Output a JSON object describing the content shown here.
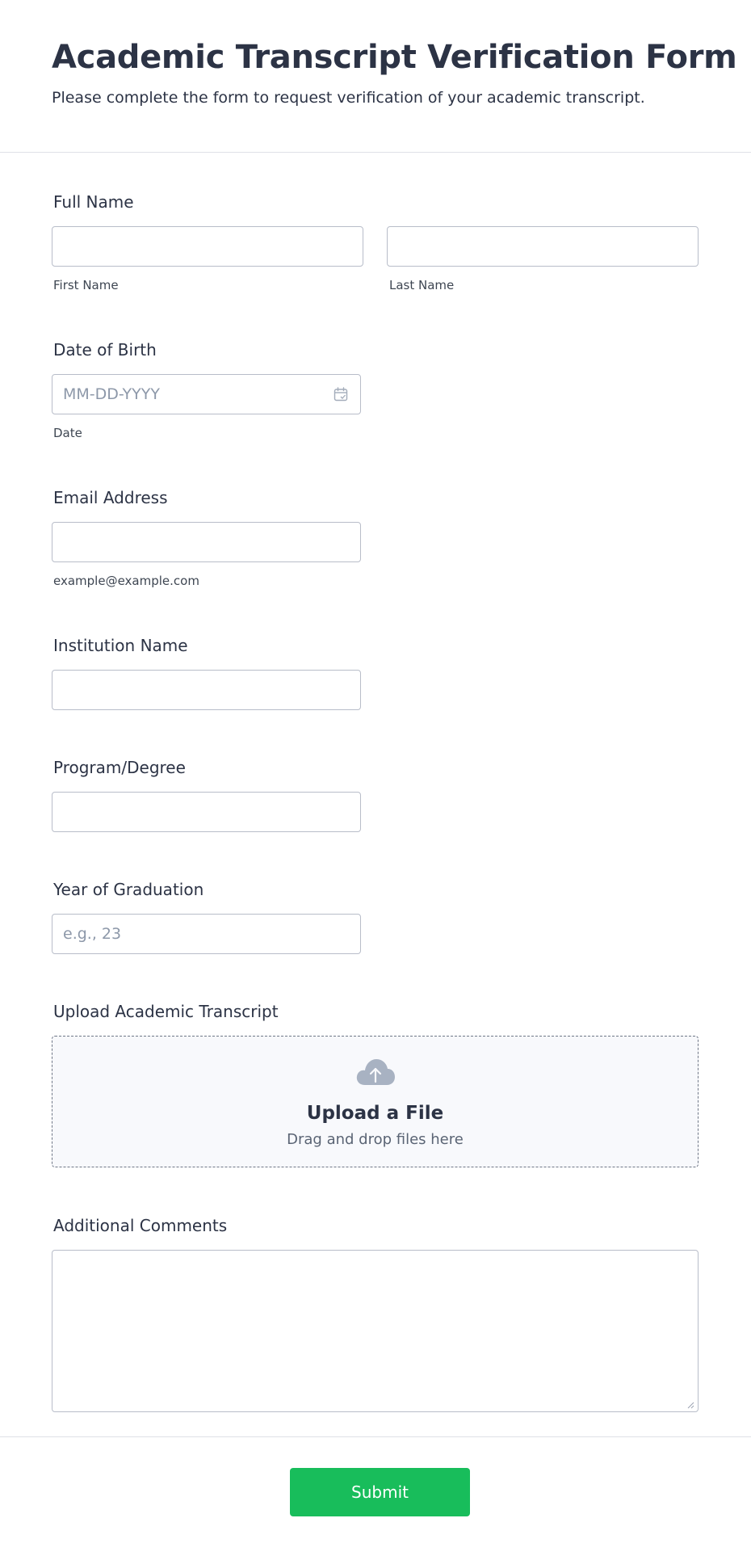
{
  "header": {
    "title": "Academic Transcript Verification Form",
    "subtitle": "Please complete the form to request verification of your academic transcript."
  },
  "fields": {
    "full_name": {
      "label": "Full Name",
      "first_sublabel": "First Name",
      "last_sublabel": "Last Name",
      "first_value": "",
      "last_value": ""
    },
    "date_of_birth": {
      "label": "Date of Birth",
      "placeholder": "MM-DD-YYYY",
      "sublabel": "Date",
      "value": "",
      "icon": "calendar-icon"
    },
    "email": {
      "label": "Email Address",
      "sublabel": "example@example.com",
      "value": ""
    },
    "institution": {
      "label": "Institution Name",
      "value": ""
    },
    "program": {
      "label": "Program/Degree",
      "value": ""
    },
    "graduation_year": {
      "label": "Year of Graduation",
      "placeholder": "e.g., 23",
      "value": ""
    },
    "transcript_upload": {
      "label": "Upload Academic Transcript",
      "title": "Upload a File",
      "hint": "Drag and drop files here",
      "icon": "cloud-upload-icon"
    },
    "comments": {
      "label": "Additional Comments",
      "value": ""
    }
  },
  "footer": {
    "submit_label": "Submit"
  },
  "colors": {
    "text": "#2c3345",
    "input_border": "#b8bdc9",
    "placeholder": "#8d98a9",
    "upload_bg": "#f8f9fc",
    "submit_bg": "#18bd5b",
    "divider": "#dfe1e7"
  }
}
